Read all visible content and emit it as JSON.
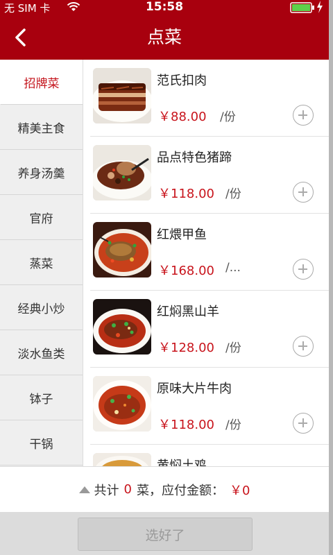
{
  "status_bar": {
    "carrier": "无 SIM 卡",
    "time": "15:58"
  },
  "header": {
    "title": "点菜"
  },
  "categories": [
    {
      "label": "招牌菜",
      "active": true
    },
    {
      "label": "精美主食",
      "active": false
    },
    {
      "label": "养身汤羹",
      "active": false
    },
    {
      "label": "官府",
      "active": false
    },
    {
      "label": "蒸菜",
      "active": false
    },
    {
      "label": "经典小炒",
      "active": false
    },
    {
      "label": "淡水鱼类",
      "active": false
    },
    {
      "label": "钵子",
      "active": false
    },
    {
      "label": "干锅",
      "active": false
    }
  ],
  "dishes": [
    {
      "name": "范氏扣肉",
      "price": "￥88.00",
      "unit": "/份"
    },
    {
      "name": "品点特色猪蹄",
      "price": "￥118.00",
      "unit": "/份"
    },
    {
      "name": "红煨甲鱼",
      "price": "￥168.00",
      "unit": "/..."
    },
    {
      "name": "红焖黑山羊",
      "price": "￥128.00",
      "unit": "/份"
    },
    {
      "name": "原味大片牛肉",
      "price": "￥118.00",
      "unit": "/份"
    },
    {
      "name": "黄焖土鸡",
      "price": "",
      "unit": ""
    }
  ],
  "summary": {
    "prefix": "共计",
    "count": "0",
    "middle": "菜，应付金额：",
    "amount": "￥0"
  },
  "footer": {
    "confirm_label": "选好了"
  },
  "colors": {
    "header": "#a8000e",
    "accent": "#c8141c"
  }
}
